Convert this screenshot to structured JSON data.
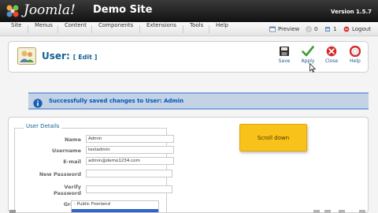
{
  "header": {
    "logo_text": "Joomla!",
    "site_name": "Demo Site",
    "version": "Version 1.5.7"
  },
  "menu": {
    "items": [
      "Site",
      "Menus",
      "Content",
      "Components",
      "Extensions",
      "Tools",
      "Help"
    ]
  },
  "status": {
    "preview": "Preview",
    "messages_count": "0",
    "users_count": "1",
    "logout": "Logout"
  },
  "toolbar": {
    "title": "User:",
    "subtitle": "[ Edit ]",
    "save": "Save",
    "apply": "Apply",
    "close": "Close",
    "help": "Help"
  },
  "message": {
    "text": "Successfully saved changes to User: Admin"
  },
  "user_details": {
    "legend": "User Details",
    "fields": {
      "name_label": "Name",
      "name_value": "Admin",
      "username_label": "Username",
      "username_value": "testadmin",
      "email_label": "E-mail",
      "email_value": "admin@demo1234.com",
      "new_password_label": "New Password",
      "new_password_value": "",
      "verify_password_label_1": "Verify",
      "verify_password_label_2": "Password",
      "verify_password_value": "",
      "group_label": "Group",
      "group_option_1": "- Public Frontend"
    }
  },
  "overlay": {
    "scroll_label": "Scroll down"
  },
  "colors": {
    "header_bg": "#1a1a1a",
    "title_blue": "#146295",
    "message_bg": "#c3d2e5",
    "message_text": "#0055bb",
    "scroll_button": "#f8c21a"
  }
}
